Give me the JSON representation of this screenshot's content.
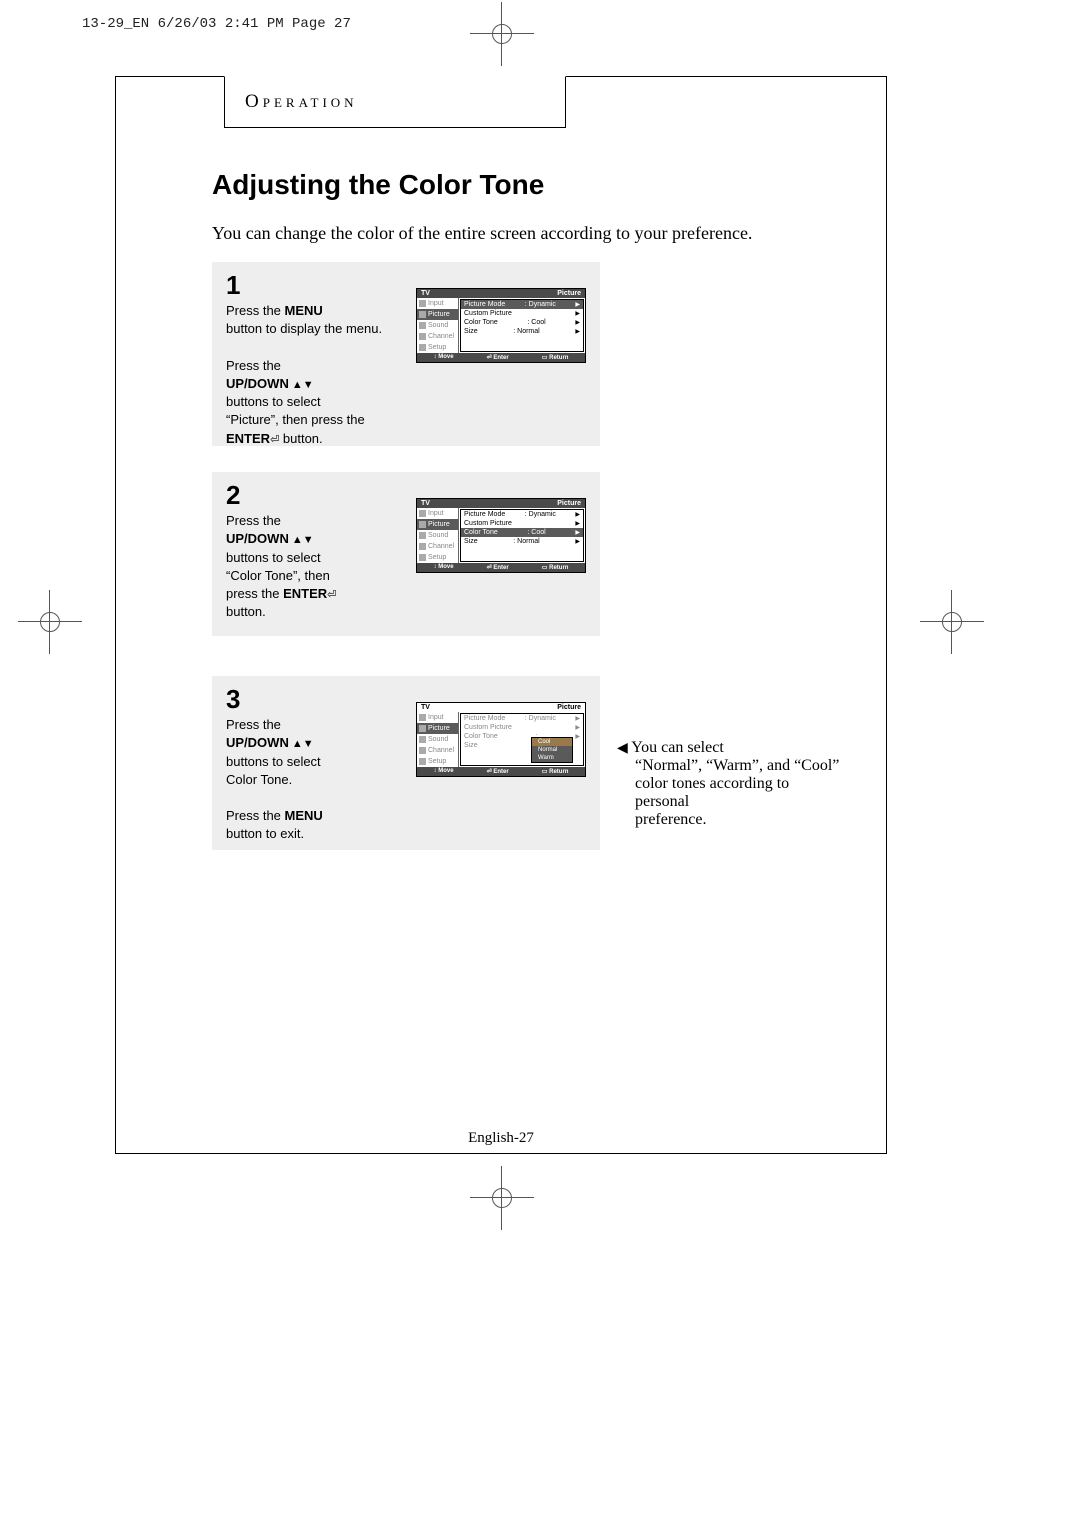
{
  "slug": "13-29_EN  6/26/03 2:41 PM  Page 27",
  "section": "Operation",
  "title": "Adjusting the Color Tone",
  "intro": "You can change the color of the entire screen according to your preference.",
  "steps": {
    "one": {
      "num": "1",
      "line1a": "Press the ",
      "line1b": "MENU",
      "line2": "button to display the menu.",
      "line3": "Press the",
      "line4a": "UP/DOWN",
      "line4arrows": " ▲▼",
      "line5": "buttons to select",
      "line6": "“Picture”, then press the",
      "line7a": "ENTER",
      "line7b": " button.",
      "enterGlyph": "⏎"
    },
    "two": {
      "num": "2",
      "line1": "Press the",
      "line2a": "UP/DOWN",
      "line2arrows": " ▲▼",
      "line3": "buttons to select",
      "line4": "“Color Tone”, then",
      "line5a": "press the ",
      "line5b": "ENTER",
      "line6": "button.",
      "enterGlyph": "⏎"
    },
    "three": {
      "num": "3",
      "line1": "Press the",
      "line2a": "UP/DOWN",
      "line2arrows": " ▲▼",
      "line3": "buttons to select",
      "line4": "Color Tone.",
      "line5a": "Press the ",
      "line5b": "MENU",
      "line6": "button to exit."
    }
  },
  "sidenote": {
    "tri": "◀",
    "l1": "You can select",
    "l2": "“Normal”, “Warm”, and “Cool”",
    "l3": "color tones according to personal",
    "l4": "preference."
  },
  "osd": {
    "hdrLeft": "TV",
    "hdrRight": "Picture",
    "side": [
      "Input",
      "Picture",
      "Sound",
      "Channel",
      "Setup"
    ],
    "rows": {
      "pictureMode": {
        "k": "Picture Mode",
        "v": ": Dynamic"
      },
      "customPicture": {
        "k": "Custom Picture",
        "v": ""
      },
      "colorTone": {
        "k": "Color Tone",
        "v": ": Cool"
      },
      "size": {
        "k": "Size",
        "v": ": Normal"
      }
    },
    "popup": [
      "Cool",
      "Normal",
      "Warm"
    ],
    "foot": {
      "move": "↕ Move",
      "enter": "⏎ Enter",
      "return": "▭ Return"
    }
  },
  "pagenum": {
    "a": "English-",
    "b": "27"
  }
}
